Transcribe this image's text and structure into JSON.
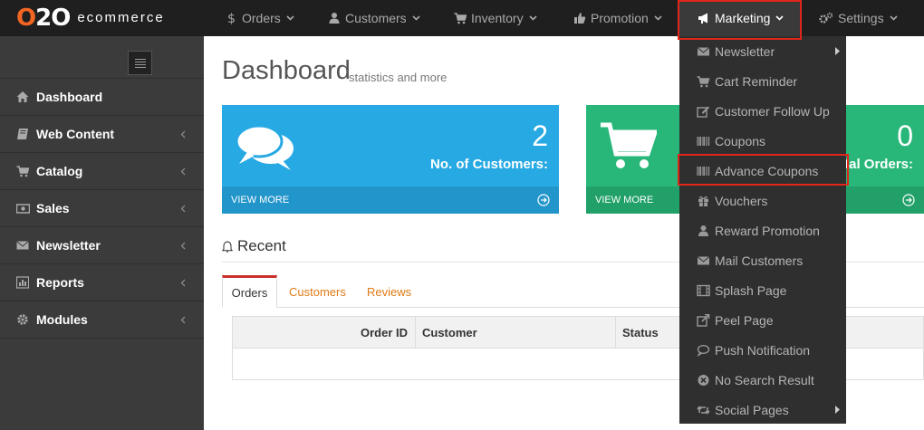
{
  "app": {
    "logo_mark_o": "O",
    "logo_mark_rest": "2O",
    "logo_text": "ecommerce"
  },
  "topnav": {
    "items": [
      {
        "label": "Orders",
        "icon": "dollar-icon"
      },
      {
        "label": "Customers",
        "icon": "user-icon"
      },
      {
        "label": "Inventory",
        "icon": "cart-icon"
      },
      {
        "label": "Promotion",
        "icon": "thumbs-up-icon"
      },
      {
        "label": "Marketing",
        "icon": "megaphone-icon",
        "active": true
      },
      {
        "label": "Settings",
        "icon": "gears-icon"
      }
    ]
  },
  "sidebar": {
    "items": [
      {
        "label": "Dashboard",
        "icon": "home-icon"
      },
      {
        "label": "Web Content",
        "icon": "book-icon"
      },
      {
        "label": "Catalog",
        "icon": "cart-icon"
      },
      {
        "label": "Sales",
        "icon": "money-icon"
      },
      {
        "label": "Newsletter",
        "icon": "envelope-icon"
      },
      {
        "label": "Reports",
        "icon": "bar-chart-icon"
      },
      {
        "label": "Modules",
        "icon": "gear-icon"
      }
    ]
  },
  "main": {
    "title": "Dashboard",
    "subtitle": "statistics and more",
    "cards": [
      {
        "value": "2",
        "label": "No. of Customers:",
        "footer": "VIEW MORE",
        "color": "#27a9e3",
        "icon": "comments-icon"
      },
      {
        "value": "0",
        "label": "Total Orders:",
        "footer": "VIEW MORE",
        "color": "#28b779",
        "icon": "shopping-cart-icon"
      }
    ],
    "recent_title": "Recent",
    "tabs": [
      "Orders",
      "Customers",
      "Reviews"
    ],
    "table_headers": [
      "Order ID",
      "Customer",
      "Status"
    ]
  },
  "marketing_menu": {
    "items": [
      {
        "label": "Newsletter",
        "icon": "envelope-icon",
        "submenu": true
      },
      {
        "label": "Cart Reminder",
        "icon": "cart-icon"
      },
      {
        "label": "Customer Follow Up",
        "icon": "edit-icon"
      },
      {
        "label": "Coupons",
        "icon": "barcode-icon"
      },
      {
        "label": "Advance Coupons",
        "icon": "barcode-icon",
        "highlighted": true
      },
      {
        "label": "Vouchers",
        "icon": "gift-icon"
      },
      {
        "label": "Reward Promotion",
        "icon": "user-icon"
      },
      {
        "label": "Mail Customers",
        "icon": "envelope-icon"
      },
      {
        "label": "Splash Page",
        "icon": "film-icon"
      },
      {
        "label": "Peel Page",
        "icon": "external-link-icon"
      },
      {
        "label": "Push Notification",
        "icon": "comment-icon"
      },
      {
        "label": "No Search Result",
        "icon": "times-circle-icon"
      },
      {
        "label": "Social Pages",
        "icon": "retweet-icon",
        "submenu": true
      }
    ]
  },
  "colors": {
    "accent_red": "#e0261b",
    "topbar": "#1f1f1f",
    "sidebar": "#3b3b3b",
    "tab_link": "#e07b16"
  }
}
